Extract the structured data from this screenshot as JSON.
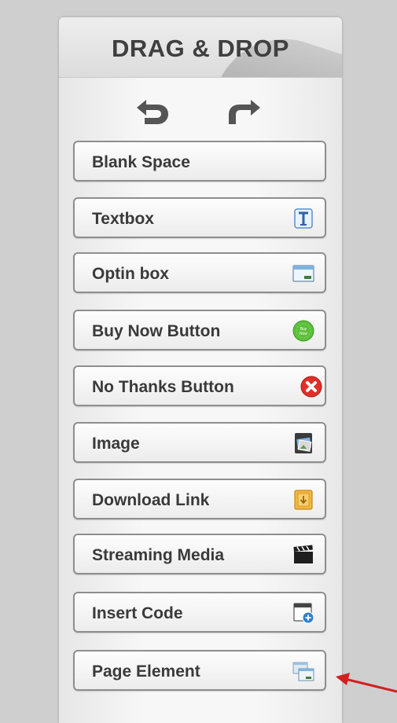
{
  "panel": {
    "title": "DRAG & DROP",
    "toolbar": {
      "undo_icon": "undo-arrow-icon",
      "redo_icon": "redo-arrow-icon"
    },
    "items": [
      {
        "label": "Blank Space",
        "icon": ""
      },
      {
        "label": "Textbox",
        "icon": "textbox-icon"
      },
      {
        "label": "Optin box",
        "icon": "optin-box-icon"
      },
      {
        "label": "Buy Now Button",
        "icon": "buy-now-icon",
        "icon_text": [
          "Buy",
          "Now"
        ]
      },
      {
        "label": "No Thanks Button",
        "icon": "no-thanks-icon"
      },
      {
        "label": "Image",
        "icon": "image-icon"
      },
      {
        "label": "Download Link",
        "icon": "download-icon"
      },
      {
        "label": "Streaming Media",
        "icon": "clapperboard-icon"
      },
      {
        "label": "Insert Code",
        "icon": "insert-code-icon"
      },
      {
        "label": "Page Element",
        "icon": "page-element-icon"
      }
    ]
  },
  "colors": {
    "annotation_arrow": "#d12020",
    "buy_now_green": "#5cbf3a",
    "no_thanks_red": "#e0302a"
  }
}
